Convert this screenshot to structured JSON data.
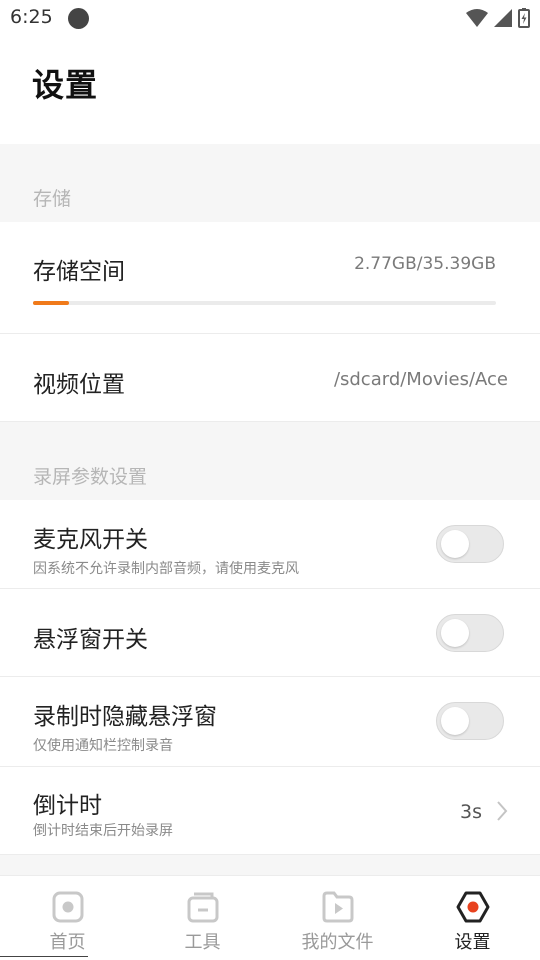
{
  "status_bar": {
    "time": "6:25"
  },
  "header": {
    "title": "设置"
  },
  "sections": {
    "storage": "存储",
    "recording": "录屏参数设置"
  },
  "storage_space": {
    "label": "存储空间",
    "value": "2.77GB/35.39GB",
    "used_fraction": 0.078
  },
  "video_location": {
    "label": "视频位置",
    "value": "/sdcard/Movies/Ace"
  },
  "microphone": {
    "label": "麦克风开关",
    "description": "因系统不允许录制内部音频，请使用麦克风",
    "enabled": false
  },
  "floating_window": {
    "label": "悬浮窗开关",
    "enabled": false
  },
  "hide_floating": {
    "label": "录制时隐藏悬浮窗",
    "description": "仅使用通知栏控制录音",
    "enabled": false
  },
  "countdown": {
    "label": "倒计时",
    "description": "倒计时结束后开始录屏",
    "value": "3s"
  },
  "bottom_nav": {
    "items": [
      {
        "label": "首页",
        "icon": "home-icon"
      },
      {
        "label": "工具",
        "icon": "toolbox-icon"
      },
      {
        "label": "我的文件",
        "icon": "video-file-icon"
      },
      {
        "label": "设置",
        "icon": "settings-hex-icon",
        "active": true
      }
    ]
  },
  "colors": {
    "accent": "#f07a1a",
    "active_icon": "#e8421e",
    "section_bg": "#f6f6f6"
  }
}
